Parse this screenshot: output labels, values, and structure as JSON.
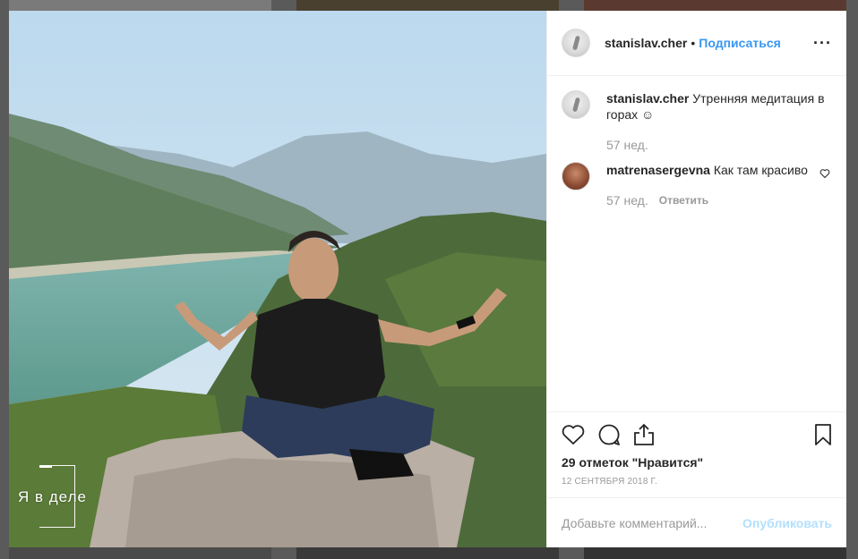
{
  "post": {
    "author": "stanislav.cher",
    "separator": "•",
    "follow_label": "Подписаться",
    "more_label": "···",
    "watermark_text": "Я в деле"
  },
  "comments": [
    {
      "user": "stanislav.cher",
      "text": "Утренняя медитация в горах ☺",
      "time": "57 нед."
    },
    {
      "user": "matrenasergevna",
      "text": "Как там красиво",
      "time": "57 нед.",
      "reply_label": "Ответить"
    }
  ],
  "actions": {
    "likes_text": "29 отметок \"Нравится\"",
    "date_text": "12 СЕНТЯБРЯ 2018 Г."
  },
  "composer": {
    "placeholder": "Добавьте комментарий...",
    "publish_label": "Опубликовать"
  },
  "colors": {
    "link_blue": "#3897f0",
    "publish_disabled": "#b2dffc",
    "text_primary": "#262626",
    "text_secondary": "#999999"
  }
}
